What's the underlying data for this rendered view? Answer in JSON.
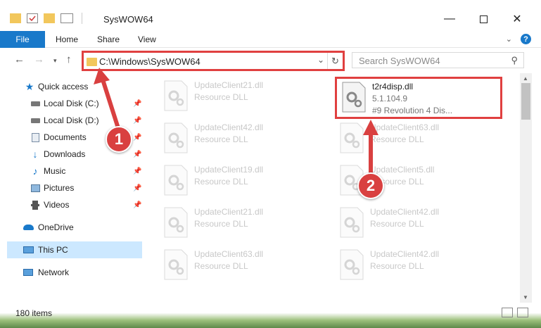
{
  "window": {
    "title": "SysWOW64"
  },
  "ribbon": {
    "file": "File",
    "tabs": [
      "Home",
      "Share",
      "View"
    ]
  },
  "address": {
    "path": "C:\\Windows\\SysWOW64"
  },
  "search": {
    "placeholder": "Search SysWOW64"
  },
  "sidebar": {
    "items": [
      {
        "label": "Quick access",
        "icon": "star-icon"
      },
      {
        "label": "Local Disk (C:)",
        "icon": "drive-icon"
      },
      {
        "label": "Local Disk (D:)",
        "icon": "drive-icon"
      },
      {
        "label": "Documents",
        "icon": "documents-icon"
      },
      {
        "label": "Downloads",
        "icon": "download-icon"
      },
      {
        "label": "Music",
        "icon": "music-icon"
      },
      {
        "label": "Pictures",
        "icon": "pictures-icon"
      },
      {
        "label": "Videos",
        "icon": "videos-icon"
      },
      {
        "label": "OneDrive",
        "icon": "cloud-icon"
      },
      {
        "label": "This PC",
        "icon": "computer-icon"
      },
      {
        "label": "Network",
        "icon": "network-icon"
      }
    ]
  },
  "files": [
    {
      "name": "UpdateClient21.dll",
      "desc": "Resource DLL"
    },
    {
      "name": "t2r4disp.dll",
      "desc": "5.1.104.9",
      "extra": "#9 Revolution 4 Dis..."
    },
    {
      "name": "UpdateClient42.dll",
      "desc": "Resource DLL"
    },
    {
      "name": "UpdateClient63.dll",
      "desc": "Resource DLL"
    },
    {
      "name": "UpdateClient19.dll",
      "desc": "Resource DLL"
    },
    {
      "name": "UpdateClient5.dll",
      "desc": "Resource DLL"
    },
    {
      "name": "UpdateClient21.dll",
      "desc": "Resource DLL"
    },
    {
      "name": "UpdateClient42.dll",
      "desc": "Resource DLL"
    },
    {
      "name": "UpdateClient63.dll",
      "desc": "Resource DLL"
    },
    {
      "name": "UpdateClient42.dll",
      "desc": "Resource DLL"
    }
  ],
  "status": {
    "items": "180 items"
  },
  "callouts": [
    "1",
    "2"
  ],
  "colors": {
    "accent": "#1979ca",
    "highlight": "#e04040",
    "selected": "#cce8ff"
  }
}
